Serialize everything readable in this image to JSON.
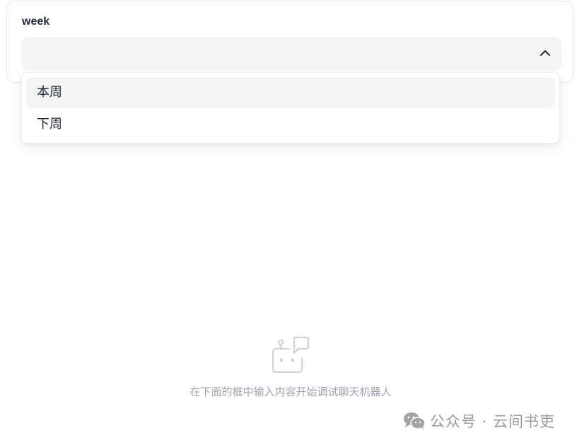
{
  "form": {
    "week_label": "week",
    "select_value": "",
    "options": [
      {
        "label": "本周",
        "highlighted": true
      },
      {
        "label": "下周",
        "highlighted": false
      }
    ]
  },
  "empty_state": {
    "icon": "chat-robot-icon",
    "text": "在下面的框中输入内容开始调试聊天机器人"
  },
  "watermark": {
    "icon": "wechat-icon",
    "text": "公众号 · 云间书吏"
  },
  "colors": {
    "select_bg": "#f3f4f6",
    "text_primary": "#1f2937",
    "text_muted": "#9ca3af"
  }
}
